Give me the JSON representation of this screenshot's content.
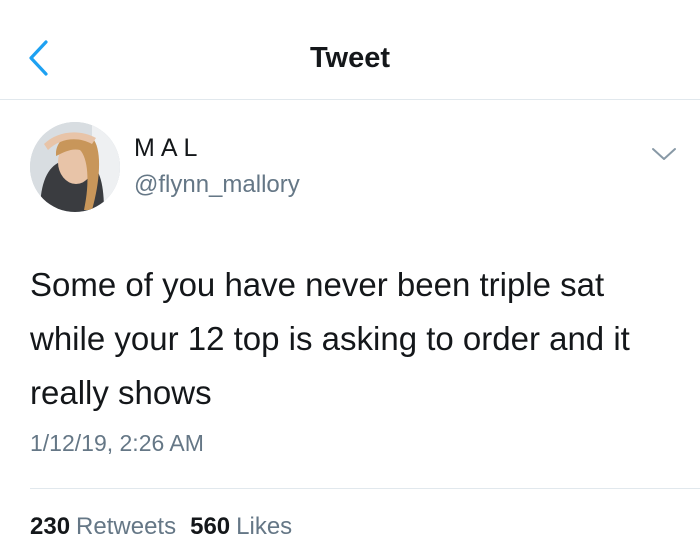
{
  "header": {
    "title": "Tweet",
    "back_icon": "chevron-left-icon",
    "accent_color": "#1da1f2"
  },
  "author": {
    "display_name": "MAL",
    "handle": "@flynn_mallory",
    "more_icon": "chevron-down-icon"
  },
  "tweet": {
    "lines": [
      "Some of you have never been triple sat",
      "while your 12 top is asking to order and it",
      "really shows"
    ],
    "timestamp": "1/12/19, 2:26 AM"
  },
  "stats": {
    "retweets_count": "230",
    "retweets_label": "Retweets",
    "likes_count": "560",
    "likes_label": "Likes"
  }
}
